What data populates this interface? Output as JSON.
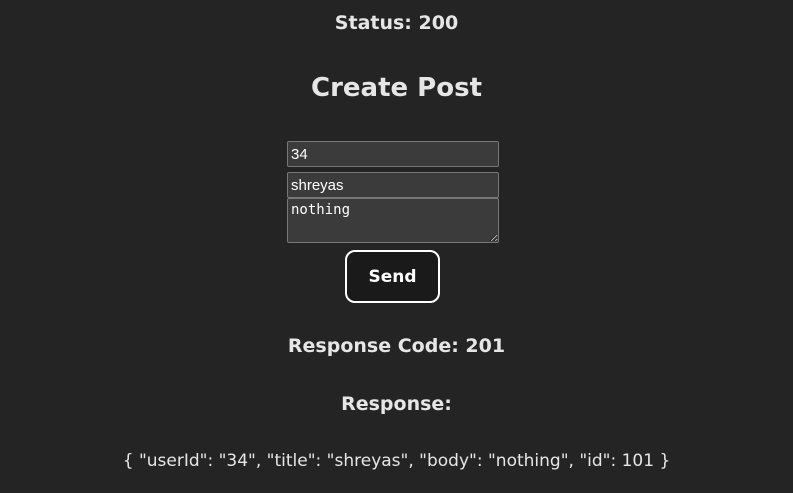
{
  "status_text": "Status: 200",
  "title": "Create Post",
  "form": {
    "user_id": "34",
    "title": "shreyas",
    "body": "nothing",
    "send_label": "Send"
  },
  "response_code_text": "Response Code: 201",
  "response_heading": "Response:",
  "response_body": "{ \"userId\": \"34\", \"title\": \"shreyas\", \"body\": \"nothing\", \"id\": 101 }"
}
